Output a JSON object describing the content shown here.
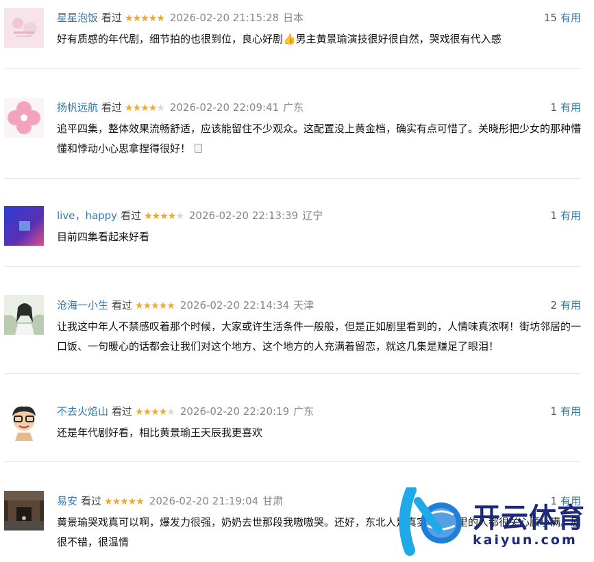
{
  "reviews": [
    {
      "user": "星星泡饭",
      "watched": "看过",
      "rating": 5,
      "time": "2026-02-20 21:15:28",
      "location": "日本",
      "useful_count": "15",
      "useful_label": "有用",
      "content": "好有质感的年代剧，细节拍的也很到位，良心好剧👍男主黄景瑜演技很好很自然，哭戏很有代入感"
    },
    {
      "user": "扬帆远航",
      "watched": "看过",
      "rating": 4,
      "time": "2026-02-20 22:09:41",
      "location": "广东",
      "useful_count": "1",
      "useful_label": "有用",
      "content": "追平四集，整体效果流畅舒适，应该能留住不少观众。这配置没上黄金档，确实有点可惜了。关晓彤把少女的那种懵懂和悸动小心思拿捏得很好！"
    },
    {
      "user": "live，happy",
      "watched": "看过",
      "rating": 4,
      "time": "2026-02-20 22:13:39",
      "location": "辽宁",
      "useful_count": "1",
      "useful_label": "有用",
      "content": "目前四集看起来好看"
    },
    {
      "user": "沧海一小生",
      "watched": "看过",
      "rating": 5,
      "time": "2026-02-20 22:14:34",
      "location": "天津",
      "useful_count": "2",
      "useful_label": "有用",
      "content": "让我这中年人不禁感叹着那个时候，大家或许生活条件一般般，但是正如剧里看到的，人情味真浓啊！街坊邻居的一口饭、一句暖心的话都会让我们对这个地方、这个地方的人充满着留恋，就这几集是赚足了眼泪！"
    },
    {
      "user": "不去火焰山",
      "watched": "看过",
      "rating": 4,
      "time": "2026-02-20 22:20:19",
      "location": "广东",
      "useful_count": "1",
      "useful_label": "有用",
      "content": "还是年代剧好看，相比黄景瑜王天辰我更喜欢"
    },
    {
      "user": "易安",
      "watched": "看过",
      "rating": 5,
      "time": "2026-02-20 21:19:04",
      "location": "甘肃",
      "useful_count": "1",
      "useful_label": "有用",
      "content": "黄景瑜哭戏真可以啊，爆发力很强，奶奶去世那段我嗷嗷哭。还好，东北人是真实的一家里的人都很关心顾小满。剧很不错，很温情"
    }
  ],
  "watermark": {
    "cn": "开云体育",
    "en": "kaiyun.com"
  },
  "colors": {
    "username": "#3377aa",
    "star": "#f5a623",
    "meta": "#888888",
    "watermark": "#1d2a7a"
  }
}
